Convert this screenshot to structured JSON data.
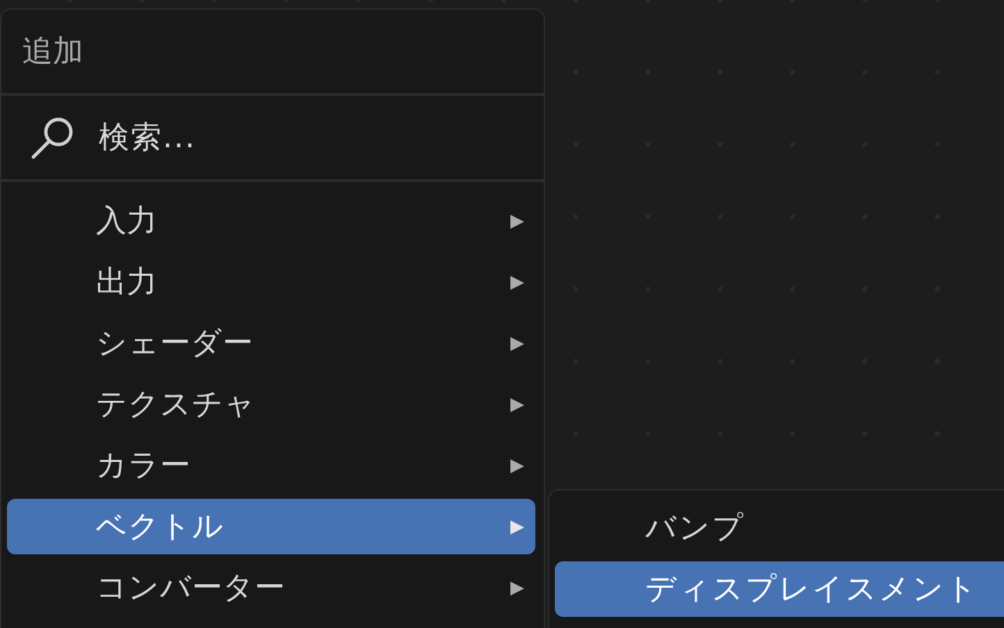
{
  "menu": {
    "title": "追加",
    "search": {
      "placeholder": "検索..."
    },
    "items": [
      {
        "label": "入力",
        "arrow": "▶",
        "selected": false
      },
      {
        "label": "出力",
        "arrow": "▶",
        "selected": false
      },
      {
        "label": "シェーダー",
        "arrow": "▶",
        "selected": false
      },
      {
        "label": "テクスチャ",
        "arrow": "▶",
        "selected": false
      },
      {
        "label": "カラー",
        "arrow": "▶",
        "selected": false
      },
      {
        "label": "ベクトル",
        "arrow": "▶",
        "selected": true
      },
      {
        "label": "コンバーター",
        "arrow": "▶",
        "selected": false
      }
    ]
  },
  "submenu": {
    "items": [
      {
        "label": "バンプ",
        "selected": false
      },
      {
        "label": "ディスプレイスメント",
        "selected": true
      }
    ]
  }
}
